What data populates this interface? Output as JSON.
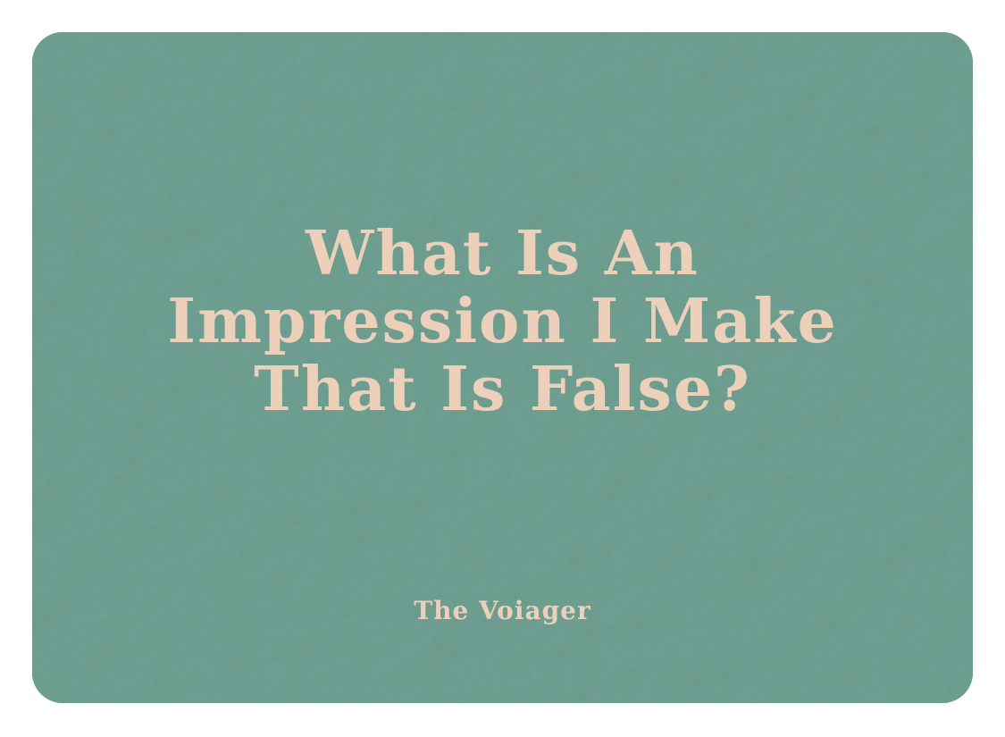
{
  "card": {
    "background_color": "#6fa193",
    "text_color": "#ecd0b9",
    "background_texture": "crumpled-paper",
    "title_lines": [
      "What Is An",
      "Impression I Make",
      "That Is False?"
    ],
    "author": "The Voiager"
  }
}
